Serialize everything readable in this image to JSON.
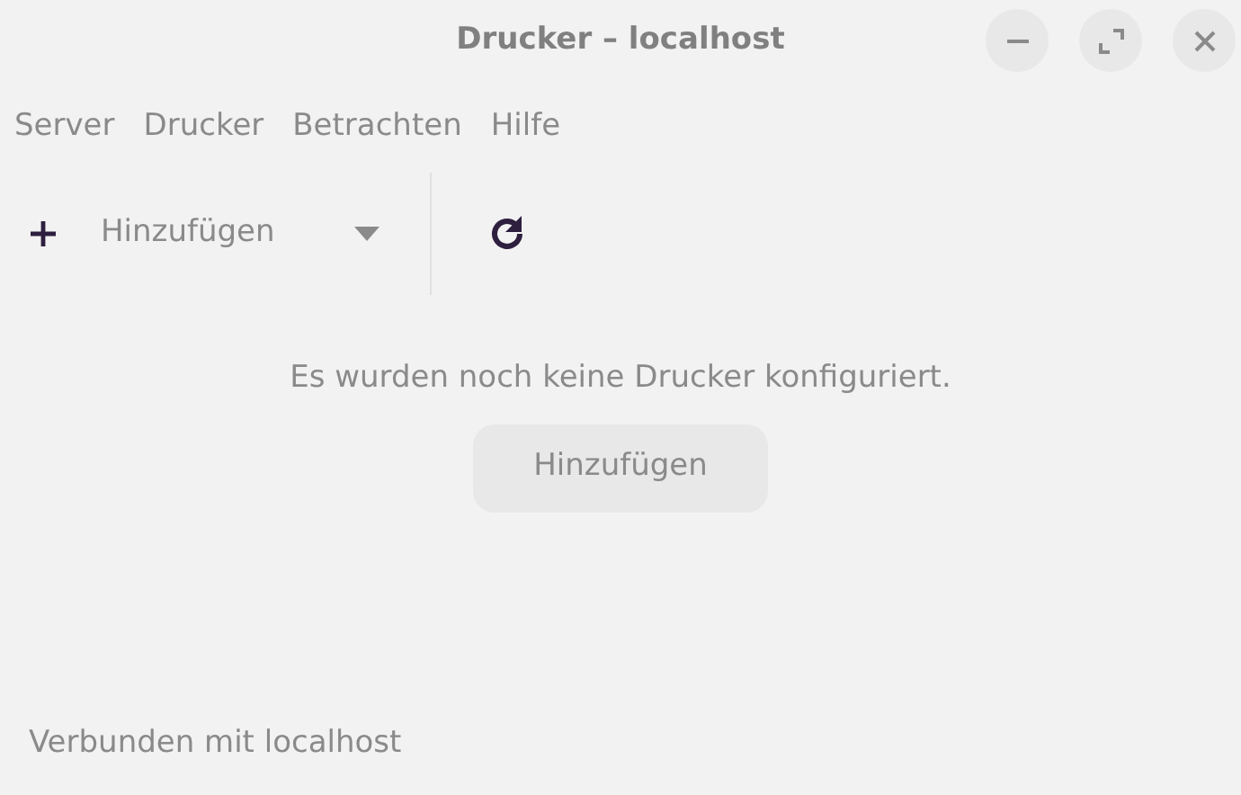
{
  "window": {
    "title": "Drucker – localhost"
  },
  "menu": [
    "Server",
    "Drucker",
    "Betrachten",
    "Hilfe"
  ],
  "toolbar": {
    "add_label": "Hinzufügen"
  },
  "message": "Es wurden noch keine Drucker konfiguriert.",
  "add_button": {
    "label": "Hinzufügen",
    "disabled": true
  },
  "status_bar": "Verbunden mit localhost"
}
